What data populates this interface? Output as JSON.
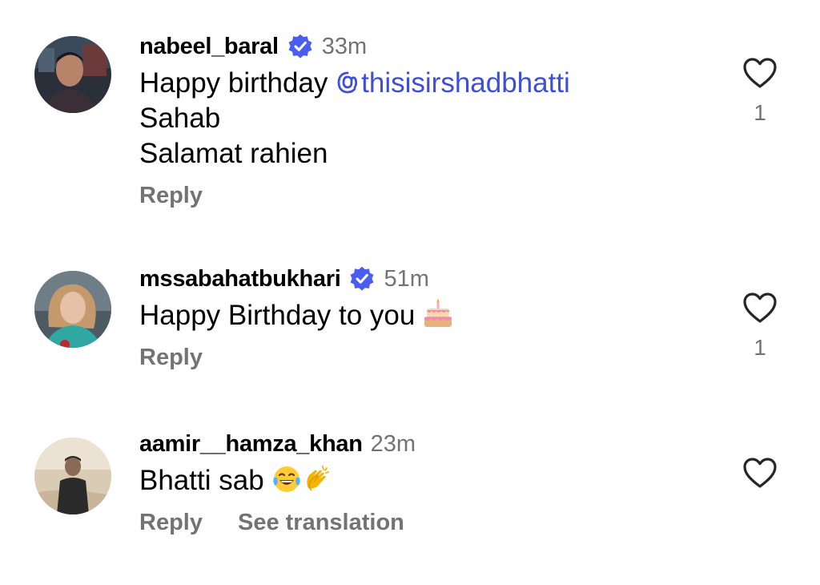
{
  "comments": [
    {
      "username": "nabeel_baral",
      "verified": true,
      "time": "33m",
      "text_prefix": "Happy birthday ",
      "mention": "thisisirshadbhatti",
      "text_lines": [
        "Sahab",
        "Salamat rahien"
      ],
      "reply_label": "Reply",
      "likes": "1"
    },
    {
      "username": "mssabahatbukhari",
      "verified": true,
      "time": "51m",
      "text": "Happy Birthday to you ",
      "emoji": [
        "birthday-cake"
      ],
      "reply_label": "Reply",
      "likes": "1"
    },
    {
      "username": "aamir__hamza_khan",
      "verified": false,
      "time": "23m",
      "text": "Bhatti sab ",
      "emoji": [
        "laughing-tears",
        "clapping-hands"
      ],
      "reply_label": "Reply",
      "translate_label": "See translation"
    }
  ],
  "colors": {
    "verified": "#4a5df0",
    "mention": "#3d4fd8",
    "secondary_text": "#737373"
  }
}
